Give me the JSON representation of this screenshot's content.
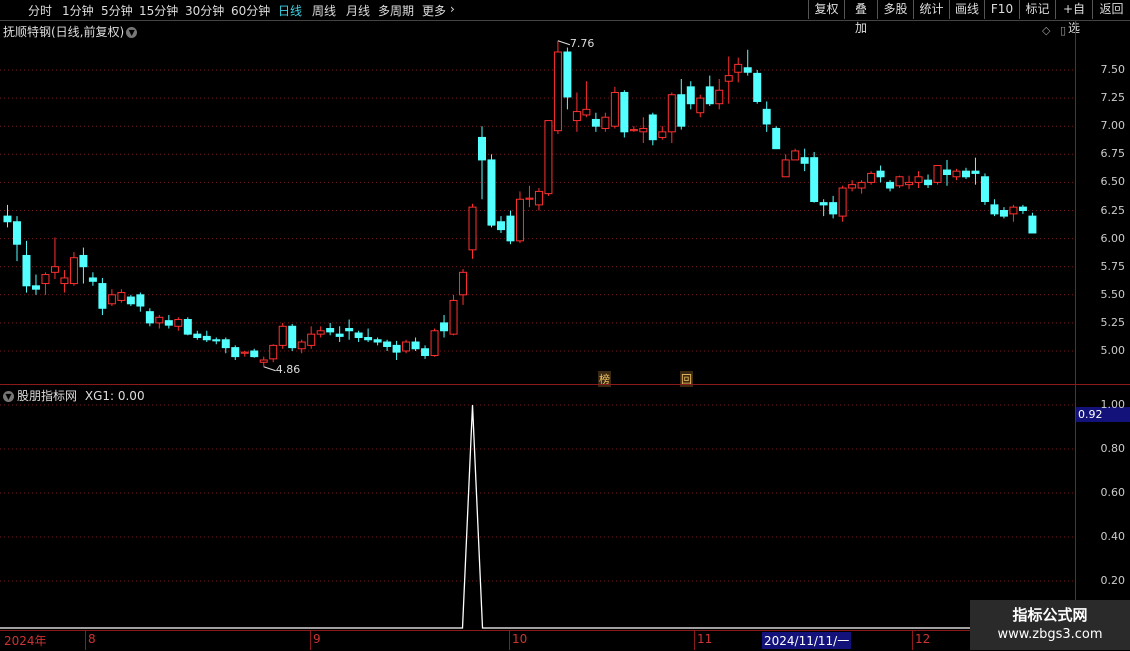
{
  "toolbar": {
    "periods": [
      "分时",
      "1分钟",
      "5分钟",
      "15分钟",
      "30分钟",
      "60分钟",
      "日线",
      "周线",
      "月线",
      "多周期",
      "更多"
    ],
    "active": "日线",
    "right": [
      "复权",
      "叠加",
      "多股",
      "统计",
      "画线",
      "F10",
      "标记",
      "+自选",
      "返回"
    ]
  },
  "kline": {
    "title": "抚顺特钢(日线,前复权)",
    "high_label": "7.76",
    "low_label": "4.86",
    "markers": [
      "榜",
      "回"
    ],
    "up_color": "#ff3030",
    "down_color": "#54ffff",
    "y_ticks": [
      "7.50",
      "7.25",
      "7.00",
      "6.75",
      "6.50",
      "6.25",
      "6.00",
      "5.75",
      "5.50",
      "5.25",
      "5.00"
    ],
    "candles": [
      [
        6.2,
        6.3,
        6.1,
        6.15
      ],
      [
        6.15,
        6.2,
        5.8,
        5.95
      ],
      [
        5.85,
        5.98,
        5.52,
        5.58
      ],
      [
        5.58,
        5.68,
        5.5,
        5.55
      ],
      [
        5.6,
        5.7,
        5.5,
        5.68
      ],
      [
        5.7,
        6.01,
        5.64,
        5.75
      ],
      [
        5.6,
        5.72,
        5.52,
        5.65
      ],
      [
        5.6,
        5.88,
        5.58,
        5.83
      ],
      [
        5.85,
        5.92,
        5.6,
        5.75
      ],
      [
        5.65,
        5.7,
        5.58,
        5.62
      ],
      [
        5.6,
        5.65,
        5.32,
        5.38
      ],
      [
        5.42,
        5.55,
        5.4,
        5.5
      ],
      [
        5.45,
        5.55,
        5.43,
        5.52
      ],
      [
        5.48,
        5.5,
        5.4,
        5.42
      ],
      [
        5.5,
        5.52,
        5.35,
        5.4
      ],
      [
        5.35,
        5.38,
        5.22,
        5.25
      ],
      [
        5.25,
        5.32,
        5.2,
        5.3
      ],
      [
        5.27,
        5.32,
        5.2,
        5.23
      ],
      [
        5.22,
        5.3,
        5.18,
        5.28
      ],
      [
        5.28,
        5.3,
        5.14,
        5.15
      ],
      [
        5.15,
        5.18,
        5.1,
        5.12
      ],
      [
        5.13,
        5.18,
        5.08,
        5.1
      ],
      [
        5.1,
        5.12,
        5.06,
        5.09
      ],
      [
        5.1,
        5.12,
        4.98,
        5.03
      ],
      [
        5.03,
        5.05,
        4.92,
        4.95
      ],
      [
        4.98,
        5.0,
        4.95,
        4.99
      ],
      [
        5.0,
        5.02,
        4.94,
        4.95
      ],
      [
        4.9,
        4.95,
        4.86,
        4.92
      ],
      [
        4.93,
        5.06,
        4.9,
        5.05
      ],
      [
        5.05,
        5.25,
        5.02,
        5.22
      ],
      [
        5.22,
        5.24,
        5.0,
        5.03
      ],
      [
        5.02,
        5.1,
        4.98,
        5.08
      ],
      [
        5.05,
        5.22,
        5.02,
        5.15
      ],
      [
        5.15,
        5.22,
        5.12,
        5.18
      ],
      [
        5.2,
        5.25,
        5.14,
        5.17
      ],
      [
        5.15,
        5.22,
        5.08,
        5.13
      ],
      [
        5.2,
        5.28,
        5.1,
        5.18
      ],
      [
        5.16,
        5.18,
        5.08,
        5.12
      ],
      [
        5.12,
        5.2,
        5.08,
        5.1
      ],
      [
        5.1,
        5.12,
        5.05,
        5.08
      ],
      [
        5.08,
        5.1,
        5.0,
        5.04
      ],
      [
        5.05,
        5.09,
        4.92,
        4.99
      ],
      [
        5.0,
        5.1,
        4.98,
        5.08
      ],
      [
        5.08,
        5.12,
        5.0,
        5.02
      ],
      [
        5.02,
        5.05,
        4.93,
        4.96
      ],
      [
        4.96,
        5.2,
        4.95,
        5.18
      ],
      [
        5.25,
        5.32,
        5.12,
        5.18
      ],
      [
        5.15,
        5.5,
        5.14,
        5.45
      ],
      [
        5.5,
        5.73,
        5.41,
        5.7
      ],
      [
        5.9,
        6.31,
        5.82,
        6.28
      ],
      [
        6.9,
        7.0,
        6.35,
        6.7
      ],
      [
        6.7,
        6.75,
        6.1,
        6.12
      ],
      [
        6.15,
        6.2,
        6.05,
        6.08
      ],
      [
        6.2,
        6.25,
        5.95,
        5.98
      ],
      [
        5.98,
        6.42,
        5.96,
        6.35
      ],
      [
        6.35,
        6.47,
        6.28,
        6.36
      ],
      [
        6.3,
        6.45,
        6.25,
        6.42
      ],
      [
        6.4,
        7.05,
        6.38,
        7.05
      ],
      [
        6.96,
        7.76,
        6.93,
        7.66
      ],
      [
        7.66,
        7.7,
        7.15,
        7.26
      ],
      [
        7.05,
        7.3,
        6.95,
        7.13
      ],
      [
        7.1,
        7.4,
        7.08,
        7.15
      ],
      [
        7.06,
        7.12,
        6.95,
        7.0
      ],
      [
        6.98,
        7.12,
        6.95,
        7.08
      ],
      [
        7.0,
        7.35,
        6.98,
        7.3
      ],
      [
        7.3,
        7.32,
        6.9,
        6.95
      ],
      [
        6.96,
        7.0,
        6.95,
        6.97
      ],
      [
        6.95,
        7.08,
        6.85,
        6.98
      ],
      [
        7.1,
        7.12,
        6.83,
        6.88
      ],
      [
        6.9,
        7.0,
        6.88,
        6.95
      ],
      [
        6.95,
        7.3,
        6.85,
        7.28
      ],
      [
        7.28,
        7.42,
        6.97,
        7.0
      ],
      [
        7.35,
        7.4,
        7.15,
        7.2
      ],
      [
        7.12,
        7.28,
        7.08,
        7.25
      ],
      [
        7.35,
        7.45,
        7.18,
        7.2
      ],
      [
        7.2,
        7.42,
        7.15,
        7.32
      ],
      [
        7.4,
        7.62,
        7.2,
        7.45
      ],
      [
        7.48,
        7.61,
        7.39,
        7.55
      ],
      [
        7.52,
        7.68,
        7.45,
        7.48
      ],
      [
        7.47,
        7.5,
        7.2,
        7.22
      ],
      [
        7.15,
        7.22,
        6.95,
        7.02
      ],
      [
        6.98,
        7.0,
        6.82,
        6.8
      ],
      [
        6.55,
        6.75,
        6.58,
        6.7
      ],
      [
        6.7,
        6.8,
        6.7,
        6.78
      ],
      [
        6.72,
        6.8,
        6.6,
        6.67
      ],
      [
        6.72,
        6.77,
        6.32,
        6.33
      ],
      [
        6.32,
        6.35,
        6.2,
        6.3
      ],
      [
        6.32,
        6.38,
        6.18,
        6.22
      ],
      [
        6.2,
        6.47,
        6.15,
        6.45
      ],
      [
        6.45,
        6.52,
        6.42,
        6.48
      ],
      [
        6.45,
        6.52,
        6.4,
        6.5
      ],
      [
        6.5,
        6.6,
        6.48,
        6.58
      ],
      [
        6.6,
        6.65,
        6.5,
        6.55
      ],
      [
        6.5,
        6.52,
        6.42,
        6.45
      ],
      [
        6.47,
        6.56,
        6.45,
        6.55
      ],
      [
        6.48,
        6.56,
        6.44,
        6.5
      ],
      [
        6.5,
        6.6,
        6.45,
        6.55
      ],
      [
        6.52,
        6.57,
        6.45,
        6.48
      ],
      [
        6.5,
        6.62,
        6.48,
        6.65
      ],
      [
        6.61,
        6.7,
        6.47,
        6.57
      ],
      [
        6.55,
        6.62,
        6.52,
        6.6
      ],
      [
        6.6,
        6.63,
        6.53,
        6.55
      ],
      [
        6.6,
        6.72,
        6.48,
        6.58
      ],
      [
        6.55,
        6.58,
        6.3,
        6.33
      ],
      [
        6.3,
        6.35,
        6.2,
        6.22
      ],
      [
        6.25,
        6.28,
        6.18,
        6.2
      ],
      [
        6.22,
        6.3,
        6.15,
        6.28
      ],
      [
        6.28,
        6.3,
        6.22,
        6.25
      ],
      [
        6.2,
        6.23,
        6.05,
        6.05
      ]
    ]
  },
  "indicator": {
    "title": "股朋指标网",
    "series_label": "XG1: 0.00",
    "cursor_value": "0.92",
    "y_ticks": [
      "1.00",
      "0.80",
      "0.60",
      "0.40",
      "0.20"
    ]
  },
  "dates": {
    "labels": [
      "2024年",
      "8",
      "9",
      "10",
      "11",
      "2024/11/11/一",
      "12"
    ]
  },
  "watermark": {
    "line1": "指标公式网",
    "line2": "www.zbgs3.com"
  }
}
